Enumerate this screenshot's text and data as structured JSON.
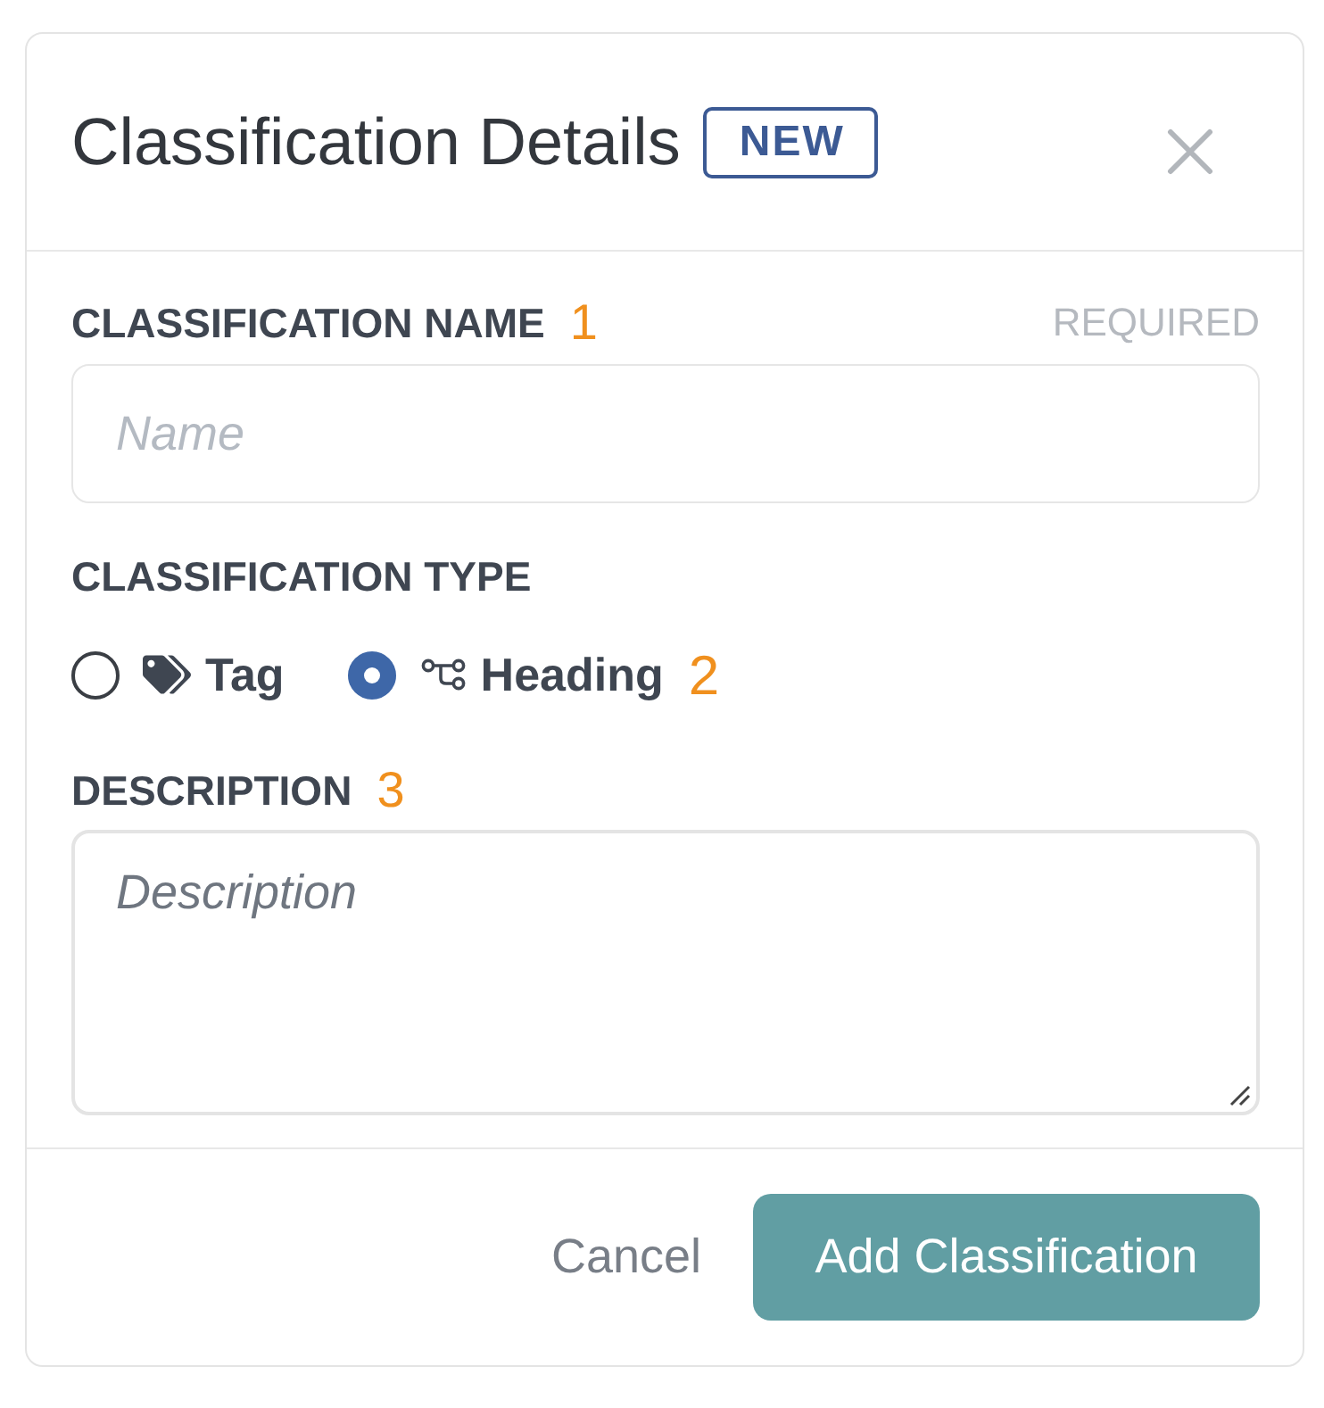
{
  "dialog": {
    "title": "Classification Details",
    "badge": "NEW"
  },
  "fields": [
    {
      "kind": "text",
      "label": "CLASSIFICATION NAME",
      "callout": "1",
      "hint": "REQUIRED",
      "placeholder": "Name"
    },
    {
      "kind": "radio",
      "label": "CLASSIFICATION TYPE",
      "options": [
        {
          "kind": "tag",
          "label": "Tag",
          "selected": false
        },
        {
          "kind": "heading",
          "label": "Heading",
          "selected": true,
          "callout": "2"
        }
      ]
    },
    {
      "kind": "textarea",
      "label": "DESCRIPTION",
      "callout": "3",
      "placeholder": "Description"
    }
  ],
  "footer": {
    "buttons": [
      {
        "kind": "link",
        "label": "Cancel"
      },
      {
        "kind": "primary",
        "label": "Add Classification"
      }
    ]
  }
}
